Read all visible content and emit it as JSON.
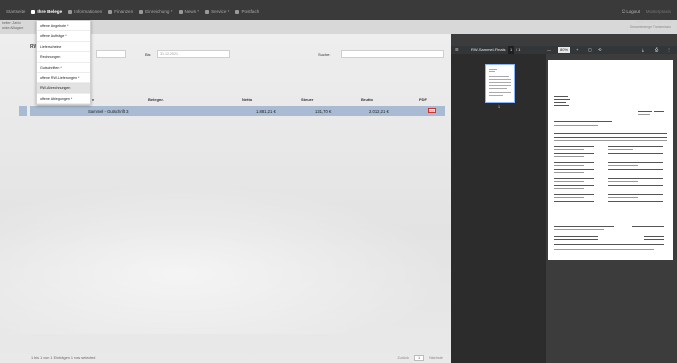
{
  "nav": {
    "items": [
      {
        "label": "Startseite",
        "icon": "home-icon",
        "active": false
      },
      {
        "label": "Ihre Belege",
        "icon": "receipt-icon",
        "active": true
      },
      {
        "label": "Informationen",
        "icon": "info-icon",
        "active": false
      },
      {
        "label": "Finanzen",
        "icon": "euro-icon",
        "active": false
      },
      {
        "label": "Einreichung *",
        "icon": "upload-icon",
        "active": false
      },
      {
        "label": "News *",
        "icon": "news-icon",
        "active": false
      },
      {
        "label": "Service *",
        "icon": "service-icon",
        "active": false
      },
      {
        "label": "Postfach",
        "icon": "mail-icon",
        "active": false
      }
    ],
    "sub_left_1": "beiter: Zahlo",
    "sub_left_2": "anke:Alltagsm",
    "sub_left_3": "Tel: 0 88 30 71 - 20",
    "logout": "Logout",
    "username": "Musterpraxis",
    "sub_right_1": "ehren: Praxis: Ma / 111",
    "sub_right_2": "Gesamtmenge Transmissio"
  },
  "dropdown": {
    "items": [
      "offene Angebote *",
      "offene Aufträge *",
      "Lieferscheine",
      "Rechnungen",
      "Gutschriften *",
      "offene RW-Lieferungen *",
      "RW-Abrechnungen",
      "offene Ablegungen *"
    ],
    "hover_index": 6
  },
  "page_code": "RW",
  "filters": {
    "bis_label": "Bis",
    "bis_value": "31.12.2021",
    "suche_label": "Suche:"
  },
  "table": {
    "headers": [
      "e",
      "Belegnr.",
      "Netto",
      "Steuer",
      "Brutto",
      "PDF"
    ],
    "row": {
      "name": "Sammel - Gutschrift 3",
      "netto": "1.881,21 €",
      "steuer": "131,70 €",
      "brutto": "2.012,21 €",
      "pdf": "PDF"
    }
  },
  "footer": {
    "info": "1 bis 1 von 1 Einträgen   1 row selected",
    "prev": "Zurück",
    "page": "1",
    "next": "Nächste"
  },
  "pdf": {
    "title": "RW-Sammel-Finals",
    "page_current": "1",
    "page_total": "/ 1",
    "zoom": "80%",
    "thumb_number": "1"
  }
}
